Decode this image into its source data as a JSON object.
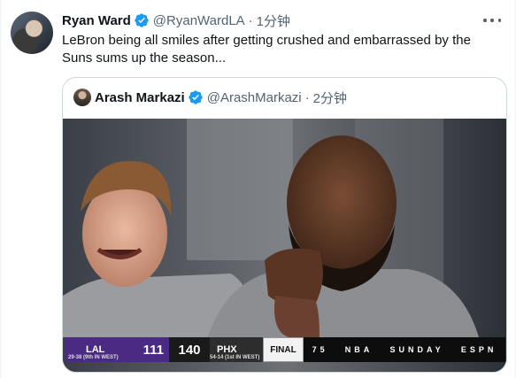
{
  "tweet": {
    "author_name": "Ryan Ward",
    "author_handle": "@RyanWardLA",
    "time": "1分钟",
    "text": "LeBron being all smiles after getting crushed and embarrassed by the Suns sums up the season..."
  },
  "quoted_tweet": {
    "author_name": "Arash Markazi",
    "author_handle": "@ArashMarkazi",
    "time": "2分钟"
  },
  "scorebug": {
    "team_home": "LAL",
    "score_home": "111",
    "score_away": "140",
    "team_away": "PHX",
    "record_home": "29-38 (9th IN WEST)",
    "record_away": "54-14 (1st IN WEST)",
    "status": "FINAL",
    "anniversary": "75",
    "league": "NBA",
    "day": "SUNDAY",
    "network": "ESPN"
  },
  "colors": {
    "verified": "#1d9bf0",
    "lakers_purple": "#4b2a84",
    "secondary_text": "#536471"
  },
  "icons": {
    "verified": "verified-badge-icon",
    "more": "more-options-icon"
  }
}
